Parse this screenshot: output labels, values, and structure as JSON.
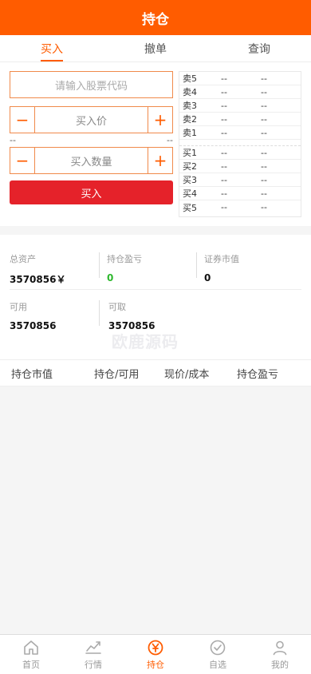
{
  "header": {
    "title": "持仓"
  },
  "tabs": [
    {
      "label": "买入",
      "active": true
    },
    {
      "label": "撤单",
      "active": false
    },
    {
      "label": "查询",
      "active": false
    }
  ],
  "trade": {
    "code_placeholder": "请输入股票代码",
    "price_label": "买入价",
    "minus_symbol": "−",
    "plus_symbol": "+",
    "limit_low": "--",
    "limit_high": "--",
    "qty_label": "买入数量",
    "buy_button": "买入"
  },
  "order_book": {
    "sell": [
      {
        "label": "卖5",
        "price": "--",
        "vol": "--"
      },
      {
        "label": "卖4",
        "price": "--",
        "vol": "--"
      },
      {
        "label": "卖3",
        "price": "--",
        "vol": "--"
      },
      {
        "label": "卖2",
        "price": "--",
        "vol": "--"
      },
      {
        "label": "卖1",
        "price": "--",
        "vol": "--"
      }
    ],
    "buy": [
      {
        "label": "买1",
        "price": "--",
        "vol": "--"
      },
      {
        "label": "买2",
        "price": "--",
        "vol": "--"
      },
      {
        "label": "买3",
        "price": "--",
        "vol": "--"
      },
      {
        "label": "买4",
        "price": "--",
        "vol": "--"
      },
      {
        "label": "买5",
        "price": "--",
        "vol": "--"
      }
    ]
  },
  "assets": {
    "total_label": "总资产",
    "total_value": "3570856￥",
    "pnl_label": "持仓盈亏",
    "pnl_value": "0",
    "market_label": "证券市值",
    "market_value": "0",
    "available_label": "可用",
    "available_value": "3570856",
    "withdrawable_label": "可取",
    "withdrawable_value": "3570856"
  },
  "watermark": {
    "text": "欧鹿源码"
  },
  "table": {
    "columns": [
      "持仓市值",
      "持仓/可用",
      "现价/成本",
      "持仓盈亏"
    ]
  },
  "bottom_nav": [
    {
      "label": "首页",
      "icon": "home-icon",
      "active": false
    },
    {
      "label": "行情",
      "icon": "chart-icon",
      "active": false
    },
    {
      "label": "持仓",
      "icon": "yen-icon",
      "active": true
    },
    {
      "label": "自选",
      "icon": "check-circle-icon",
      "active": false
    },
    {
      "label": "我的",
      "icon": "user-icon",
      "active": false
    }
  ],
  "colors": {
    "brand": "#ff5c00",
    "buy_button": "#e5222a",
    "positive": "#2eb82e"
  }
}
